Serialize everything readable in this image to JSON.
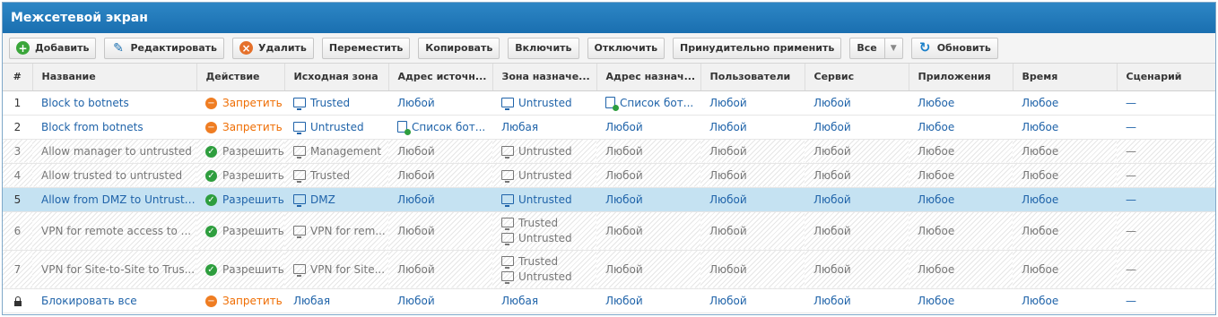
{
  "window": {
    "title": "Межсетевой экран"
  },
  "toolbar": {
    "add": "Добавить",
    "edit": "Редактировать",
    "delete": "Удалить",
    "move": "Переместить",
    "copy": "Копировать",
    "enable": "Включить",
    "disable": "Отключить",
    "force_apply": "Принудительно применить",
    "filter": "Все",
    "refresh": "Обновить"
  },
  "columns": [
    "#",
    "Название",
    "Действие",
    "Исходная зона",
    "Адрес источн...",
    "Зона назначе...",
    "Адрес назнач...",
    "Пользователи",
    "Сервис",
    "Приложения",
    "Время",
    "Сценарий"
  ],
  "rows": [
    {
      "num": "1",
      "name": "Block to botnets",
      "action": "Запретить",
      "src_zone": [
        "Trusted"
      ],
      "src_addr": "Любой",
      "dst_zone": [
        "Untrusted"
      ],
      "dst_addr": "Список бот...",
      "users": "Любой",
      "service": "Любой",
      "apps": "Любое",
      "time": "Любое",
      "scenario": "—"
    },
    {
      "num": "2",
      "name": "Block from botnets",
      "action": "Запретить",
      "src_zone": [
        "Untrusted"
      ],
      "src_addr": "Список бот...",
      "dst_zone": [
        "Любая"
      ],
      "dst_addr": "Любой",
      "users": "Любой",
      "service": "Любой",
      "apps": "Любое",
      "time": "Любое",
      "scenario": "—"
    },
    {
      "num": "3",
      "name": "Allow manager to untrusted",
      "action": "Разрешить",
      "src_zone": [
        "Management"
      ],
      "src_addr": "Любой",
      "dst_zone": [
        "Untrusted"
      ],
      "dst_addr": "Любой",
      "users": "Любой",
      "service": "Любой",
      "apps": "Любое",
      "time": "Любое",
      "scenario": "—"
    },
    {
      "num": "4",
      "name": "Allow trusted to untrusted",
      "action": "Разрешить",
      "src_zone": [
        "Trusted"
      ],
      "src_addr": "Любой",
      "dst_zone": [
        "Untrusted"
      ],
      "dst_addr": "Любой",
      "users": "Любой",
      "service": "Любой",
      "apps": "Любое",
      "time": "Любое",
      "scenario": "—"
    },
    {
      "num": "5",
      "name": "Allow from DMZ to Untrusted",
      "action": "Разрешить",
      "src_zone": [
        "DMZ"
      ],
      "src_addr": "Любой",
      "dst_zone": [
        "Untrusted"
      ],
      "dst_addr": "Любой",
      "users": "Любой",
      "service": "Любой",
      "apps": "Любое",
      "time": "Любое",
      "scenario": "—"
    },
    {
      "num": "6",
      "name": "VPN for remote access to ...",
      "action": "Разрешить",
      "src_zone": [
        "VPN for rem..."
      ],
      "src_addr": "Любой",
      "dst_zone": [
        "Trusted",
        "Untrusted"
      ],
      "dst_addr": "Любой",
      "users": "Любой",
      "service": "Любой",
      "apps": "Любое",
      "time": "Любое",
      "scenario": "—"
    },
    {
      "num": "7",
      "name": "VPN for Site-to-Site to Trus...",
      "action": "Разрешить",
      "src_zone": [
        "VPN for Site..."
      ],
      "src_addr": "Любой",
      "dst_zone": [
        "Trusted",
        "Untrusted"
      ],
      "dst_addr": "Любой",
      "users": "Любой",
      "service": "Любой",
      "apps": "Любое",
      "time": "Любое",
      "scenario": "—"
    },
    {
      "num": "",
      "name": "Блокировать все",
      "action": "Запретить",
      "src_zone": [
        "Любая"
      ],
      "src_addr": "Любой",
      "dst_zone": [
        "Любая"
      ],
      "dst_addr": "Любой",
      "users": "Любой",
      "service": "Любой",
      "apps": "Любое",
      "time": "Любое",
      "scenario": "—"
    }
  ]
}
